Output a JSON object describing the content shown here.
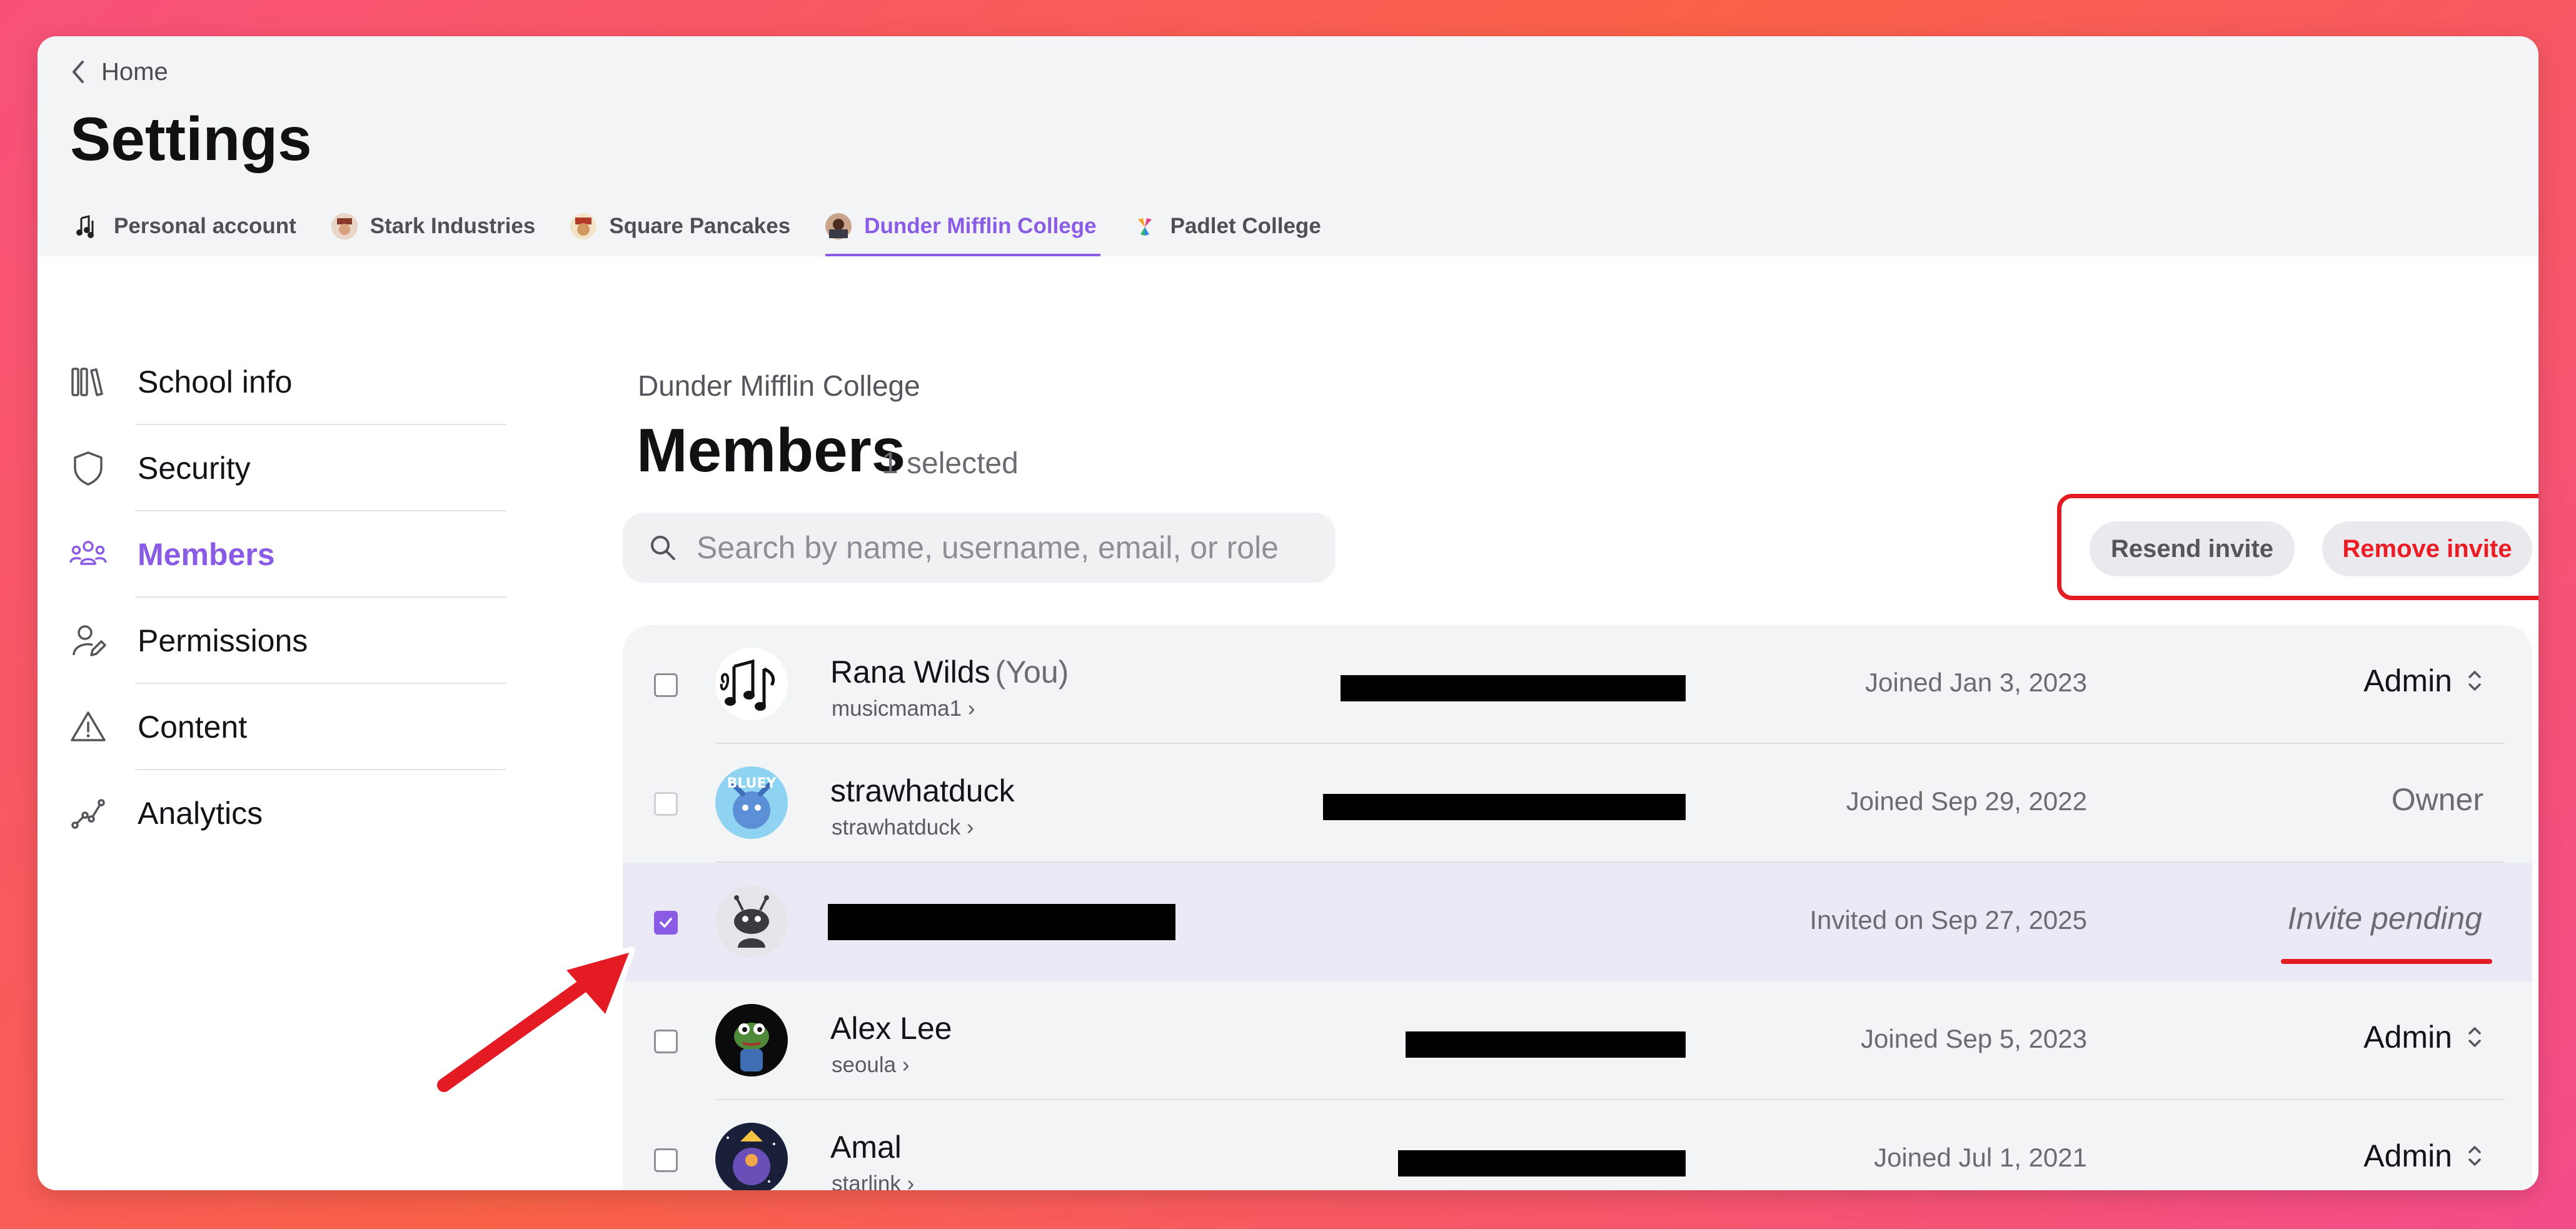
{
  "breadcrumb": {
    "home_label": "Home"
  },
  "page": {
    "title": "Settings"
  },
  "accounts_tabs": [
    {
      "label": "Personal account",
      "avatar": "music-note-avatar",
      "active": false
    },
    {
      "label": "Stark Industries",
      "avatar": "org-avatar",
      "active": false
    },
    {
      "label": "Square Pancakes",
      "avatar": "org-avatar",
      "active": false
    },
    {
      "label": "Dunder Mifflin College",
      "avatar": "org-avatar",
      "active": true
    },
    {
      "label": "Padlet College",
      "avatar": "padlet-logo",
      "active": false
    }
  ],
  "sidebar": {
    "items": [
      {
        "label": "School info",
        "icon": "books-icon",
        "active": false
      },
      {
        "label": "Security",
        "icon": "shield-icon",
        "active": false
      },
      {
        "label": "Members",
        "icon": "people-icon",
        "active": true
      },
      {
        "label": "Permissions",
        "icon": "user-edit-icon",
        "active": false
      },
      {
        "label": "Content",
        "icon": "warning-icon",
        "active": false
      },
      {
        "label": "Analytics",
        "icon": "analytics-icon",
        "active": false
      }
    ]
  },
  "main": {
    "org_name": "Dunder Mifflin College",
    "title": "Members",
    "selected_count": "1 selected",
    "search_placeholder": "Search by name, username, email, or role",
    "actions": {
      "resend_label": "Resend invite",
      "remove_label": "Remove invite"
    }
  },
  "members": [
    {
      "name": "Rana Wilds",
      "you_tag": "(You)",
      "username": "musicmama1 ›",
      "email": "[redacted]",
      "joined": "Joined Jan 3, 2023",
      "role": "Admin",
      "role_editable": true,
      "checked": false,
      "checkbox_disabled": false,
      "avatar": "music-notes"
    },
    {
      "name": "strawhatduck",
      "you_tag": "",
      "username": "strawhatduck ›",
      "email": "[redacted]",
      "joined": "Joined Sep 29, 2022",
      "role": "Owner",
      "role_editable": false,
      "checked": false,
      "checkbox_disabled": true,
      "avatar": "bluey"
    },
    {
      "name": "[redacted]",
      "you_tag": "",
      "username": "",
      "email": "",
      "joined": "Invited on Sep 27, 2025",
      "role": "Invite pending",
      "role_editable": false,
      "checked": true,
      "checkbox_disabled": false,
      "avatar": "default-ant"
    },
    {
      "name": "Alex Lee",
      "you_tag": "",
      "username": "seoula ›",
      "email": "[redacted]",
      "joined": "Joined Sep 5, 2023",
      "role": "Admin",
      "role_editable": true,
      "checked": false,
      "checkbox_disabled": false,
      "avatar": "frog"
    },
    {
      "name": "Amal",
      "you_tag": "",
      "username": "starlink ›",
      "email": "[redacted]",
      "joined": "Joined Jul 1, 2021",
      "role": "Admin",
      "role_editable": true,
      "checked": false,
      "checkbox_disabled": false,
      "avatar": "space"
    }
  ],
  "colors": {
    "accent": "#8a5ce6",
    "highlight": "#e51b24",
    "selected_row": "#ece9f7"
  }
}
